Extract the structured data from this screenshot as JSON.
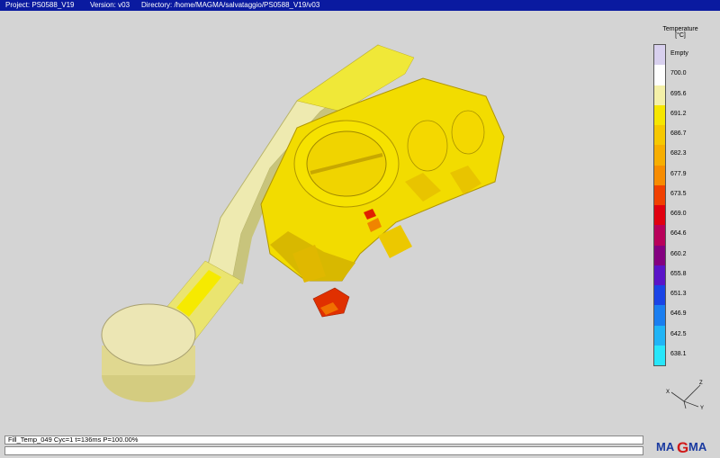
{
  "titlebar": {
    "project": "Project: PS0588_V19",
    "version": "Version: v03",
    "directory": "Directory: /home/MAGMA/salvataggio/PS0588_V19/v03"
  },
  "legend": {
    "title_line1": "Temperature",
    "title_line2": "[°C]",
    "entries": [
      {
        "label": "Empty",
        "color": "#d8d0ee"
      },
      {
        "label": "700.0",
        "color": "#ffffff"
      },
      {
        "label": "695.6",
        "color": "#f4f0a8"
      },
      {
        "label": "691.2",
        "color": "#f6e600"
      },
      {
        "label": "686.7",
        "color": "#f6c800"
      },
      {
        "label": "682.3",
        "color": "#f7ae00"
      },
      {
        "label": "677.9",
        "color": "#f78c00"
      },
      {
        "label": "673.5",
        "color": "#f04000"
      },
      {
        "label": "669.0",
        "color": "#e00010"
      },
      {
        "label": "664.6",
        "color": "#b8005a"
      },
      {
        "label": "660.2",
        "color": "#840080"
      },
      {
        "label": "655.8",
        "color": "#5a14c8"
      },
      {
        "label": "651.3",
        "color": "#1a44e6"
      },
      {
        "label": "646.9",
        "color": "#1a7ef0"
      },
      {
        "label": "642.5",
        "color": "#20b4f6"
      },
      {
        "label": "638.1",
        "color": "#28e6fa"
      }
    ]
  },
  "status": {
    "text": "Fill_Temp_049 Cyc=1 t=136ms P=100.00%",
    "input_value": ""
  },
  "logo": {
    "text_ma": "MA",
    "text_g": "G",
    "text_ma2": "MA"
  },
  "colors": {
    "titlebar": "#0a1aa0",
    "background": "#d4d4d4"
  }
}
